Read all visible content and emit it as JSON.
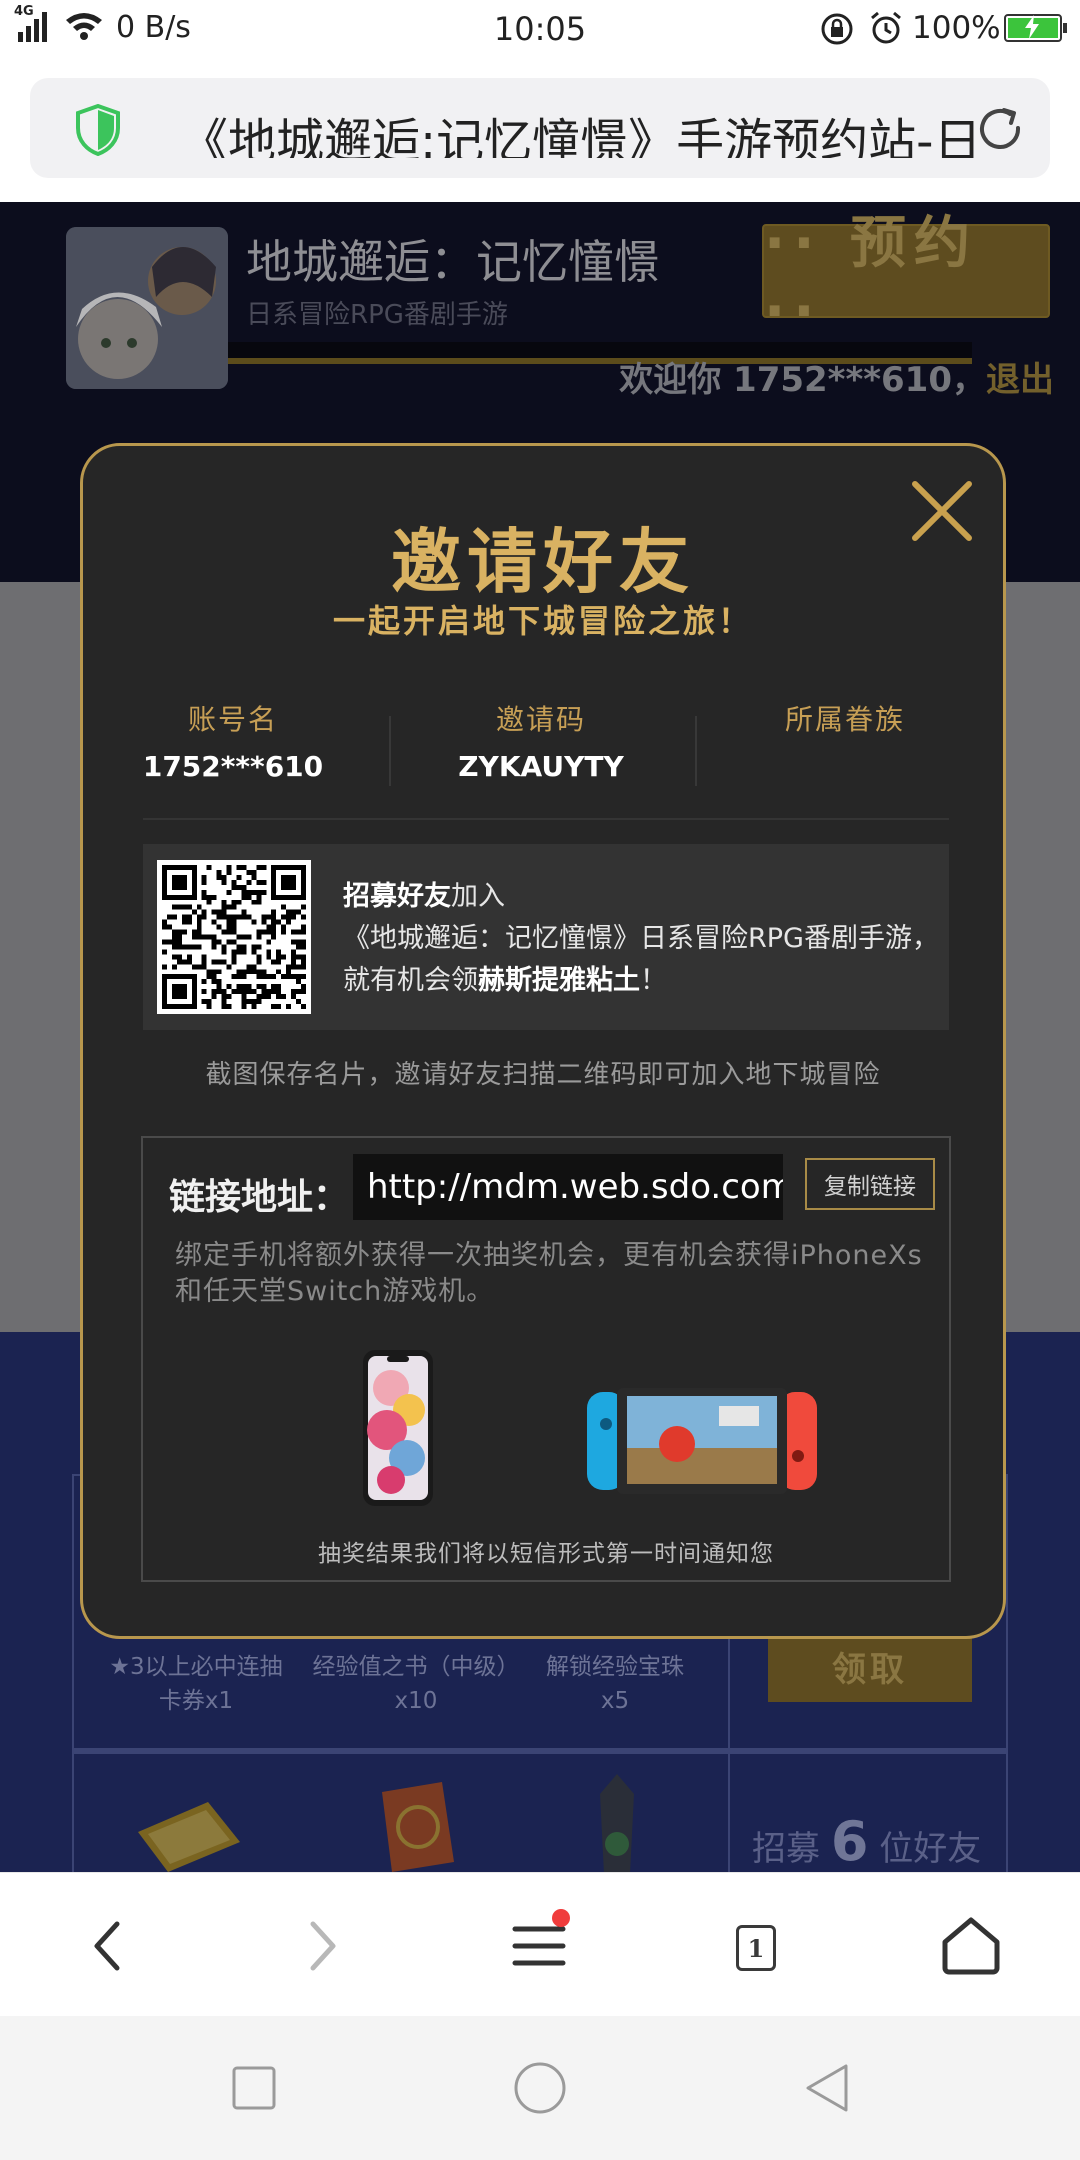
{
  "status_bar": {
    "network": "4G",
    "speed": "0 B/s",
    "time": "10:05",
    "battery": "100%"
  },
  "address_bar": {
    "title": "《地城邂逅:记忆憧憬》手游预约站-日"
  },
  "page": {
    "header": {
      "game_title": "地城邂逅：记忆憧憬",
      "game_subtitle": "日系冒险RPG番剧手游",
      "reserve_label": "·· 预约 ··",
      "welcome_prefix": "欢迎你  1752***610，",
      "logout_label": "退出"
    },
    "rewards": [
      {
        "name": "★3以上必中连抽卡券x1",
        "line1": "★3以上必中连抽",
        "line2": "卡券x1"
      },
      {
        "name": "经验值之书（中级）x10",
        "line1": "经验值之书（中级）",
        "line2": "x10"
      },
      {
        "name": "解锁经验宝珠x5",
        "line1": "解锁经验宝珠",
        "line2": "x5"
      }
    ],
    "claim_label": "领取",
    "recruit_prefix": "招募",
    "recruit_count": "6",
    "recruit_suffix": "位好友"
  },
  "modal": {
    "title": "邀请好友",
    "subtitle": "一起开启地下城冒险之旅！",
    "account_label": "账号名",
    "account_value": "1752***610",
    "code_label": "邀请码",
    "code_value": "ZYKAUYTY",
    "family_label": "所属眷族",
    "family_value": "",
    "qr_line1_bold": "招募好友",
    "qr_line1_rest": "加入",
    "qr_line2": "《地城邂逅：记忆憧憬》日系冒险RPG番剧手游，",
    "qr_line3_pre": "就有机会领",
    "qr_line3_bold": "赫斯提雅粘土",
    "qr_line3_post": "！",
    "screenshot_tip": "截图保存名片，邀请好友扫描二维码即可加入地下城冒险",
    "link_label": "链接地址：",
    "link_value": "http://mdm.web.sdo.com",
    "copy_label": "复制链接",
    "bind_tip": "绑定手机将额外获得一次抽奖机会，更有机会获得iPhoneXs和任天堂Switch游戏机。",
    "result_tip": "抽奖结果我们将以短信形式第一时间通知您"
  },
  "toolbar": {
    "tabs_count": "1"
  },
  "icons": {
    "signal": "signal-icon",
    "wifi": "wifi-icon",
    "lock": "rotation-lock-icon",
    "alarm": "alarm-icon",
    "shield": "shield-icon",
    "reload": "reload-icon",
    "close": "close-icon",
    "back": "back-icon",
    "forward": "forward-icon",
    "menu": "menu-icon",
    "home": "home-icon"
  },
  "colors": {
    "gold": "#d9b262",
    "modal_bg": "#262626",
    "modal_border": "#b8974d",
    "battery": "#3cc43c",
    "notify_dot": "#f03c3c"
  }
}
